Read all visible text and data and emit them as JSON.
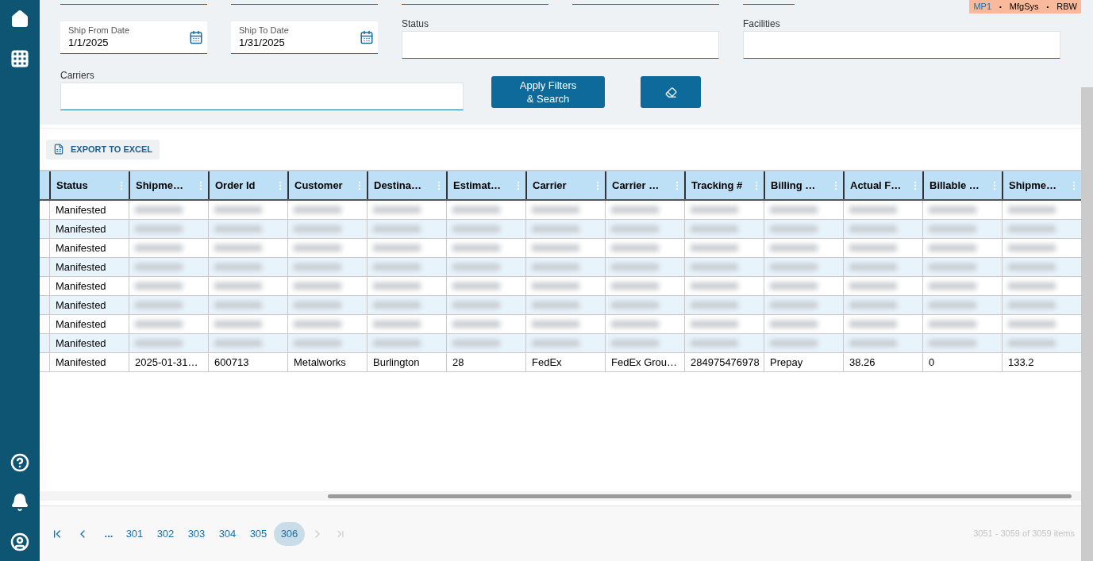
{
  "badge": {
    "items": [
      {
        "text": "MP1",
        "kind": "link"
      },
      {
        "text": "•",
        "kind": "sep"
      },
      {
        "text": "MfgSys",
        "kind": "plain"
      },
      {
        "text": "•",
        "kind": "sep"
      },
      {
        "text": "RBW",
        "kind": "plain"
      }
    ]
  },
  "sidebar": {
    "top": [
      {
        "kind": "home"
      },
      {
        "kind": "apps"
      }
    ],
    "bottom": [
      {
        "kind": "help"
      },
      {
        "kind": "bell"
      },
      {
        "kind": "user"
      }
    ]
  },
  "filters": {
    "date_fields": [
      {
        "label": "Ship From Date",
        "value": "1/1/2025"
      },
      {
        "label": "Ship To Date",
        "value": "1/31/2025"
      }
    ],
    "status": {
      "label": "Status"
    },
    "facilities": {
      "label": "Facilities"
    },
    "carriers": {
      "label": "Carriers"
    },
    "apply_button": "Apply Filters\n& Search"
  },
  "toolbar": {
    "export_button": "EXPORT TO EXCEL"
  },
  "table": {
    "columns": [
      "Status",
      "Shipme…",
      "Order Id",
      "Customer",
      "Destina…",
      "Estimat…",
      "Carrier",
      "Carrier …",
      "Tracking #",
      "Billing …",
      "Actual F…",
      "Billable …",
      "Shipme…"
    ],
    "rows": [
      {
        "redacted": true,
        "cells": [
          "Manifested"
        ]
      },
      {
        "redacted": true,
        "cells": [
          "Manifested"
        ]
      },
      {
        "redacted": true,
        "cells": [
          "Manifested"
        ]
      },
      {
        "redacted": true,
        "cells": [
          "Manifested"
        ]
      },
      {
        "redacted": true,
        "cells": [
          "Manifested"
        ]
      },
      {
        "redacted": true,
        "cells": [
          "Manifested"
        ]
      },
      {
        "redacted": true,
        "cells": [
          "Manifested"
        ]
      },
      {
        "redacted": true,
        "cells": [
          "Manifested"
        ]
      },
      {
        "redacted": false,
        "cells": [
          "Manifested",
          "2025-01-31…",
          "600713",
          "Metalworks",
          "Burlington",
          "28",
          "FedEx",
          "FedEx Grou…",
          "284975476978",
          "Prepay",
          "38.26",
          "0",
          "133.2"
        ]
      }
    ]
  },
  "pager": {
    "first_disabled": false,
    "prev_disabled": false,
    "next_disabled": true,
    "last_disabled": true,
    "ellipsis": "...",
    "pages": [
      {
        "label": "301",
        "selected": false
      },
      {
        "label": "302",
        "selected": false
      },
      {
        "label": "303",
        "selected": false
      },
      {
        "label": "304",
        "selected": false
      },
      {
        "label": "305",
        "selected": false
      },
      {
        "label": "306",
        "selected": true
      }
    ],
    "summary": "3051 - 3059 of 3059 items"
  }
}
